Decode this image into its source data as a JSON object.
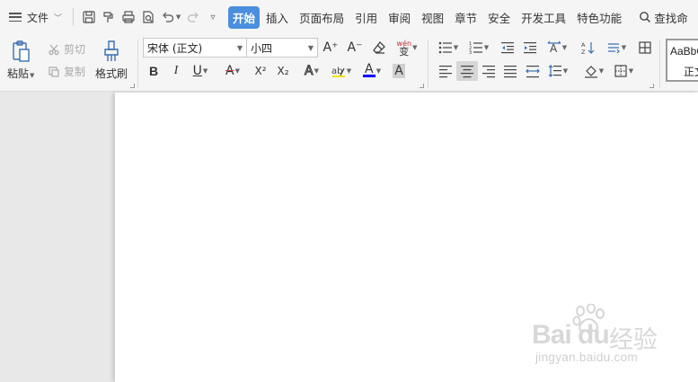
{
  "menubar": {
    "file_label": "文件",
    "tabs": [
      "开始",
      "插入",
      "页面布局",
      "引用",
      "审阅",
      "视图",
      "章节",
      "安全",
      "开发工具",
      "特色功能"
    ],
    "active_tab": "开始",
    "search_label": "查找命",
    "quick_icons": [
      "save-icon",
      "format-painter-quick-icon",
      "print-icon",
      "print-preview-icon",
      "undo-icon",
      "redo-icon",
      "customize-icon"
    ]
  },
  "clipboard": {
    "paste_label": "粘贴",
    "cut_label": "剪切",
    "copy_label": "复制",
    "format_painter_label": "格式刷"
  },
  "font": {
    "font_name": "宋体 (正文)",
    "font_size": "小四",
    "increase_label": "A⁺",
    "decrease_label": "A⁻",
    "phonetic_label": "wén",
    "bold": "B",
    "italic": "I",
    "underline": "U",
    "strike": "A",
    "superscript": "X²",
    "subscript": "X₂",
    "font_color_letter": "A",
    "char_shade_letter": "A"
  },
  "styles": {
    "preview_text": "AaBbC",
    "preview_name": "正文"
  },
  "watermark": {
    "logo": "Bai du",
    "jingyan": "经验",
    "url": "jingyan.baidu.com"
  },
  "colors": {
    "accent": "#4a8fde",
    "font_color_bar": "#0000ff",
    "strike_color": "#d04040"
  }
}
